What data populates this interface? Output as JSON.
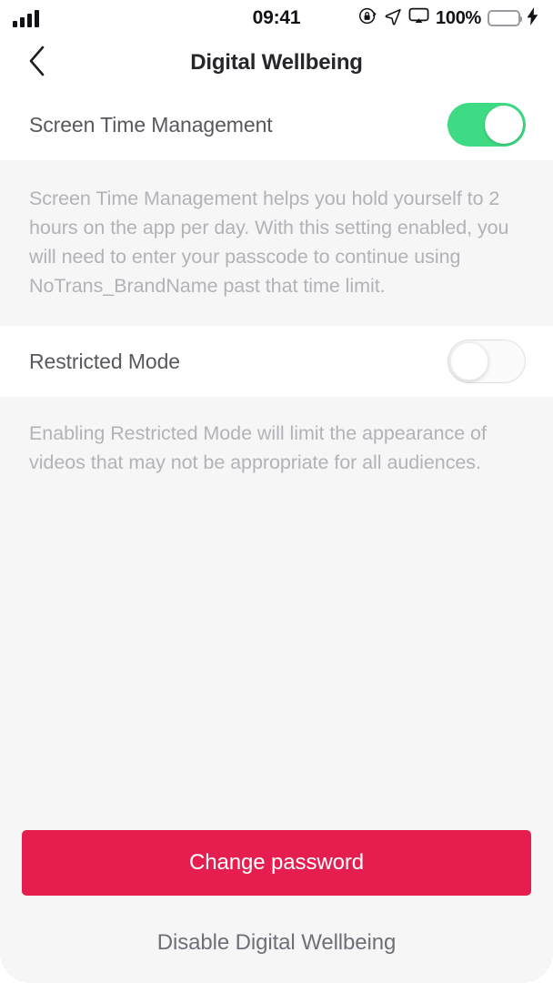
{
  "status_bar": {
    "time": "09:41",
    "battery_percent": "100%",
    "signal_icon": "signal-bars-icon",
    "rotation_lock_icon": "rotation-lock-icon",
    "location_icon": "location-arrow-icon",
    "airplay_icon": "screen-mirroring-icon",
    "battery_icon": "battery-icon",
    "charging_icon": "lightning-bolt-icon",
    "battery_color": "#3ddc7f"
  },
  "nav": {
    "back_icon": "chevron-left-icon",
    "title": "Digital Wellbeing"
  },
  "settings": [
    {
      "label": "Screen Time Management",
      "state": "on",
      "description": "Screen Time Management helps you hold yourself to 2 hours on the app per day. With this setting enabled, you will need to enter your passcode to continue using NoTrans_BrandName past that time limit."
    },
    {
      "label": "Restricted Mode",
      "state": "off",
      "description": "Enabling Restricted Mode will limit the appearance of videos that may not be appropriate for all audiences."
    }
  ],
  "footer": {
    "primary_button": "Change password",
    "secondary_link": "Disable Digital Wellbeing"
  },
  "colors": {
    "accent_red": "#e61e50",
    "toggle_on_green": "#3edb84",
    "background_gray": "#f6f6f7"
  }
}
